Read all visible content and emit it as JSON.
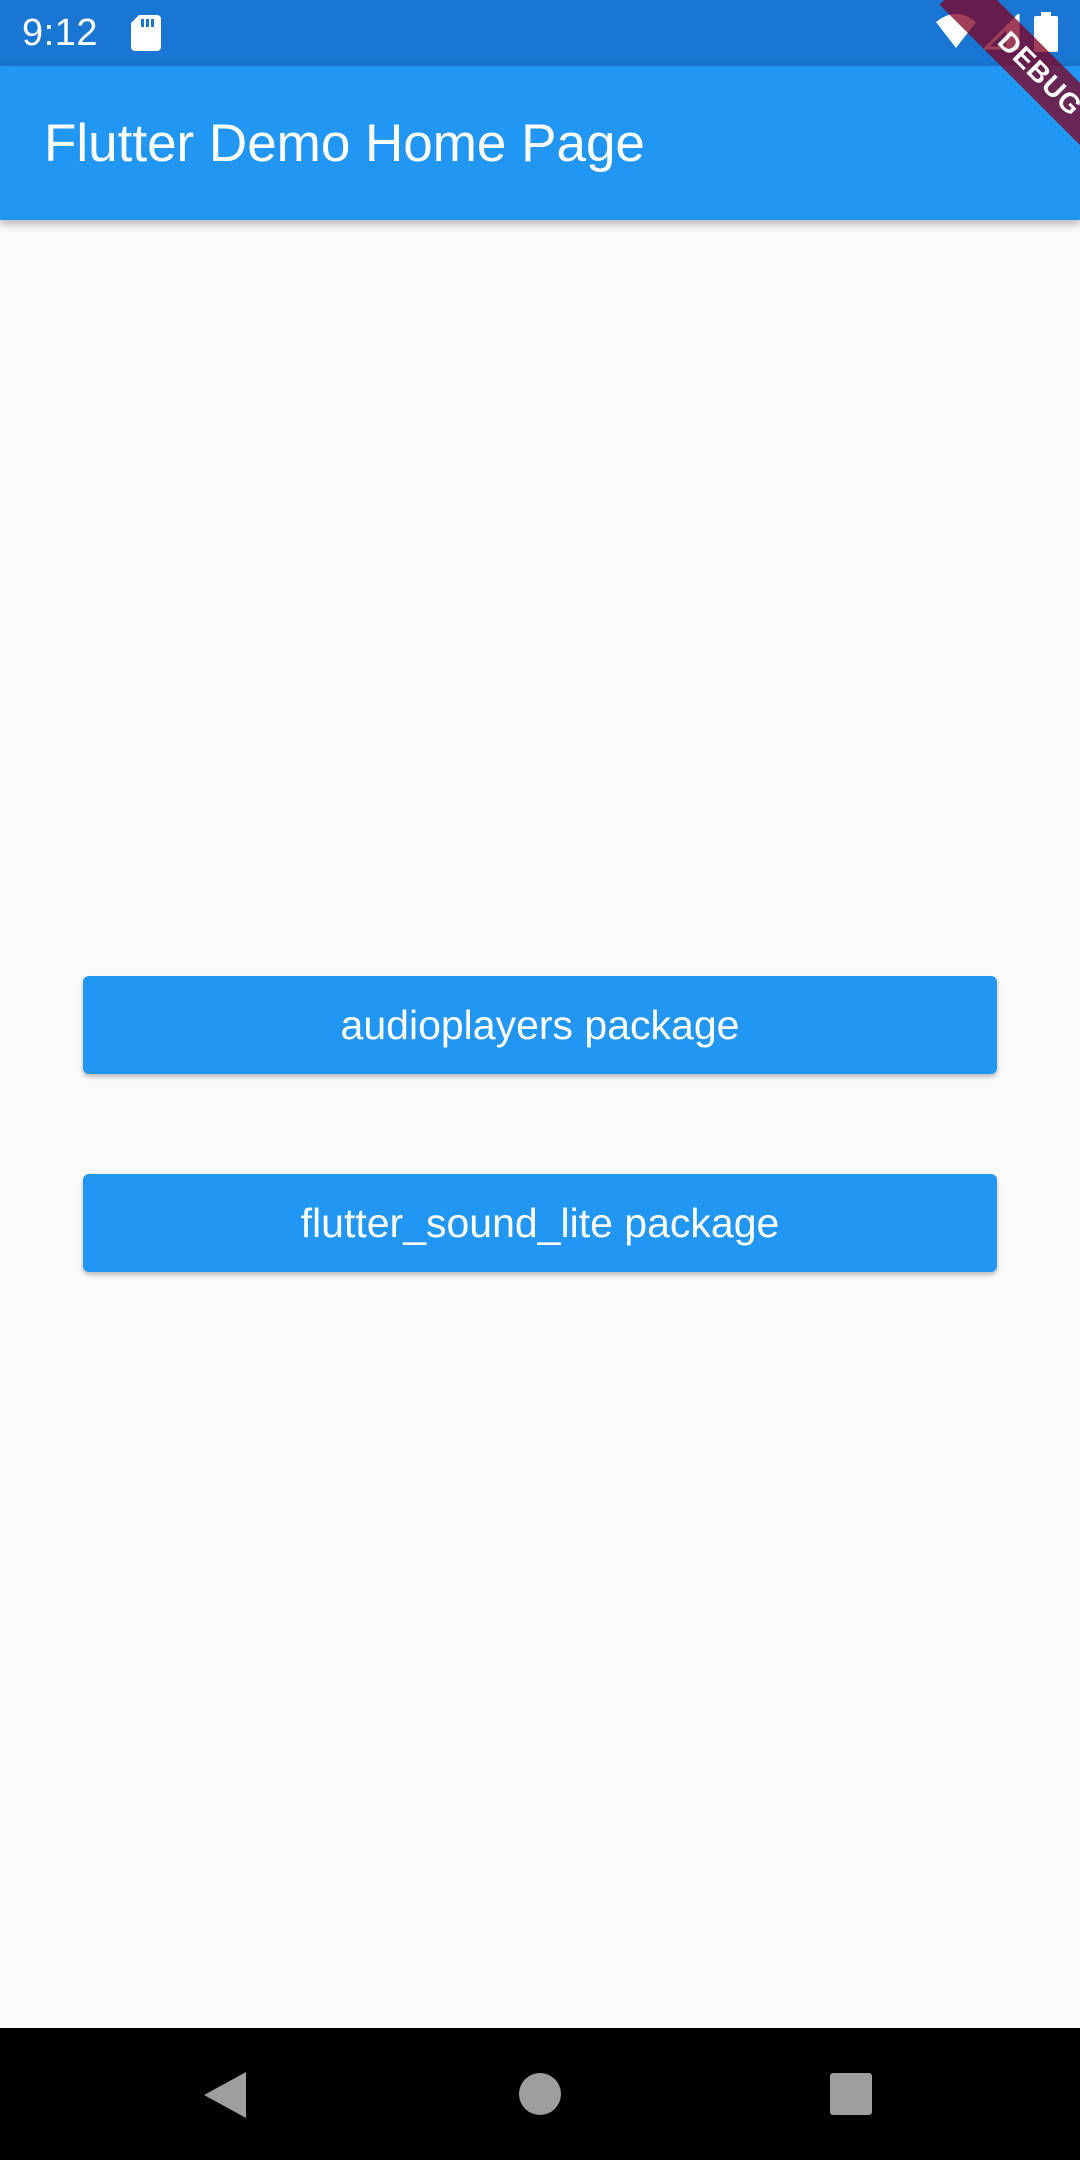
{
  "status_bar": {
    "time": "9:12",
    "icons": [
      "sd-card-icon",
      "wifi-icon",
      "signal-icon",
      "battery-icon"
    ]
  },
  "app_bar": {
    "title": "Flutter Demo Home Page"
  },
  "debug_banner": {
    "label": "DEBUG"
  },
  "buttons": [
    {
      "label": "audioplayers package"
    },
    {
      "label": "flutter_sound_lite package"
    }
  ],
  "nav_bar": {
    "icons": [
      "back-icon",
      "home-icon",
      "recents-icon"
    ]
  },
  "colors": {
    "primary": "#2196f3",
    "status_bar": "#1976d2",
    "background": "#fafafa",
    "on_primary": "#ffffff",
    "debug_banner": "#7a1f3d"
  }
}
